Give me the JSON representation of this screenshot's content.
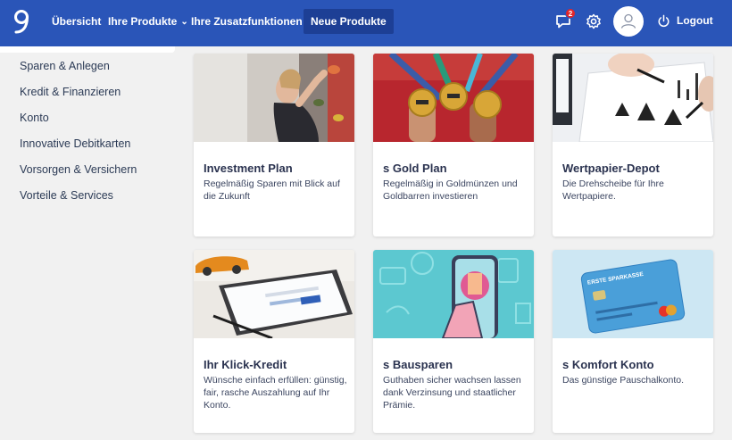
{
  "nav": {
    "items": [
      {
        "label": "Übersicht"
      },
      {
        "label": "Ihre Produkte"
      },
      {
        "label": "Ihre Zusatzfunktionen"
      },
      {
        "label": "Neue Produkte"
      }
    ],
    "notification_count": "2",
    "logout_label": "Logout",
    "icons": [
      "logo-icon",
      "chat-icon",
      "gear-icon",
      "user-icon",
      "power-icon",
      "chevron-down-icon"
    ]
  },
  "sidebar": {
    "items": [
      {
        "label": "Sparen & Anlegen"
      },
      {
        "label": "Kredit & Finanzieren"
      },
      {
        "label": "Konto"
      },
      {
        "label": "Innovative Debitkarten"
      },
      {
        "label": "Vorsorgen & Versichern"
      },
      {
        "label": "Vorteile & Services"
      }
    ]
  },
  "cards": [
    {
      "title": "Investment Plan",
      "description": "Regelmäßig Sparen mit Blick auf die Zukunft"
    },
    {
      "title": "s Gold Plan",
      "description": "Regelmäßig in Goldmünzen und Goldbarren investieren"
    },
    {
      "title": "Wertpapier-Depot",
      "description": "Die Drehscheibe für Ihre Wertpapiere."
    },
    {
      "title": "Ihr Klick-Kredit",
      "description": "Wünsche einfach erfüllen: günstig, fair, rasche Auszahlung auf Ihr Konto."
    },
    {
      "title": "s Bausparen",
      "description": "Guthaben sicher wachsen lassen dank Verzinsung und staatlicher Prämie."
    },
    {
      "title": "s Komfort Konto",
      "description": "Das günstige Pauschalkonto."
    }
  ],
  "card_brand_text": "ERSTE SPARKASSE",
  "colors": {
    "nav_bg": "#2a55b8",
    "nav_active": "#1d3f95",
    "badge": "#e2262a",
    "title": "#2b3350"
  }
}
